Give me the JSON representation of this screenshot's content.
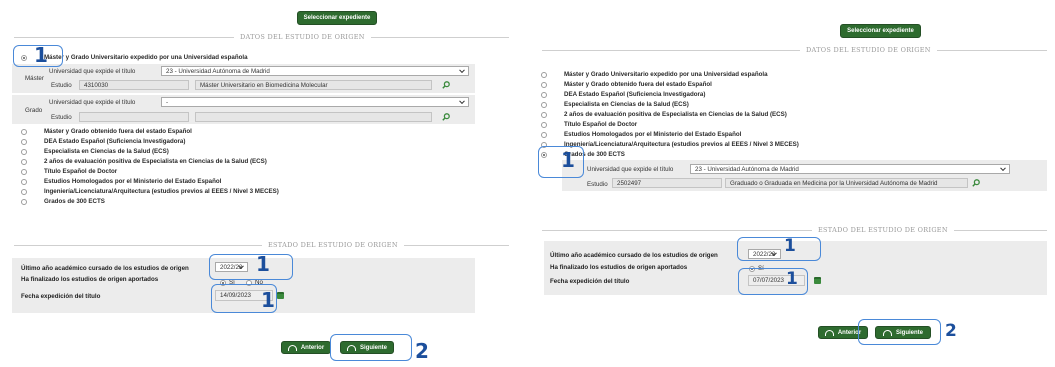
{
  "common": {
    "select_expediente_label": "Seleccionar expediente",
    "origin_section_title": "DATOS DEL ESTUDIO DE ORIGEN",
    "state_section_title": "ESTADO DEL ESTUDIO DE ORIGEN",
    "prev_button_label": "Anterior",
    "next_button_label": "Siguiente",
    "last_year_label": "Último año académico cursado de los estudios de origen",
    "finished_label": "Ha finalizado los estudios de origen aportados",
    "issue_date_label": "Fecha expedición del título",
    "university_label": "Universidad que expide el título",
    "study_label": "Estudio",
    "master_label": "Máster",
    "grado_label": "Grado",
    "accent_color": "#2e6b2f",
    "annotation_color": "#4a89d8"
  },
  "left": {
    "options": [
      "Máster y Grado Universitario expedido por una Universidad española",
      "Máster y Grado obtenido fuera del estado Español",
      "DEA Estado Español (Suficiencia Investigadora)",
      "Especialista en Ciencias de la Salud (ECS)",
      "2 años de evaluación positiva de Especialista en Ciencias de la Salud (ECS)",
      "Título Español de Doctor",
      "Estudios Homologados por el Ministerio del Estado Español",
      "Ingeniería/Licenciatura/Arquitectura (estudios previos al EEES / Nivel 3 MECES)",
      "Grados de 300 ECTS"
    ],
    "master_university": "23 - Universidad Autónoma de Madrid",
    "master_study_code": "4310030",
    "master_study_name": "Máster Universitario en Biomedicina Molecular",
    "grado_university": "-",
    "grado_study_code": "",
    "grado_study_name": "",
    "last_year": "2022/23",
    "finished_yes": "Sí",
    "finished_no": "No",
    "issue_date": "14/09/2023",
    "annotations": [
      "1",
      "1",
      "1",
      "2"
    ]
  },
  "right": {
    "options": [
      "Máster y Grado Universitario expedido por una Universidad española",
      "Máster y Grado obtenido fuera del estado Español",
      "DEA Estado Español (Suficiencia Investigadora)",
      "Especialista en Ciencias de la Salud (ECS)",
      "2 años de evaluación positiva de Especialista en Ciencias de la Salud (ECS)",
      "Título Español de Doctor",
      "Estudios Homologados por el Ministerio del Estado Español",
      "Ingeniería/Licenciatura/Arquitectura (estudios previos al EEES / Nivel 3 MECES)",
      "Grados de 300 ECTS"
    ],
    "university": "23 - Universidad Autónoma de Madrid",
    "study_code": "2502497",
    "study_name": "Graduado o Graduada en Medicina por la Universidad Autónoma de Madrid",
    "last_year": "2022/23",
    "finished_yes": "Sí",
    "issue_date": "07/07/2023",
    "annotations": [
      "1",
      "1",
      "1",
      "2"
    ]
  }
}
